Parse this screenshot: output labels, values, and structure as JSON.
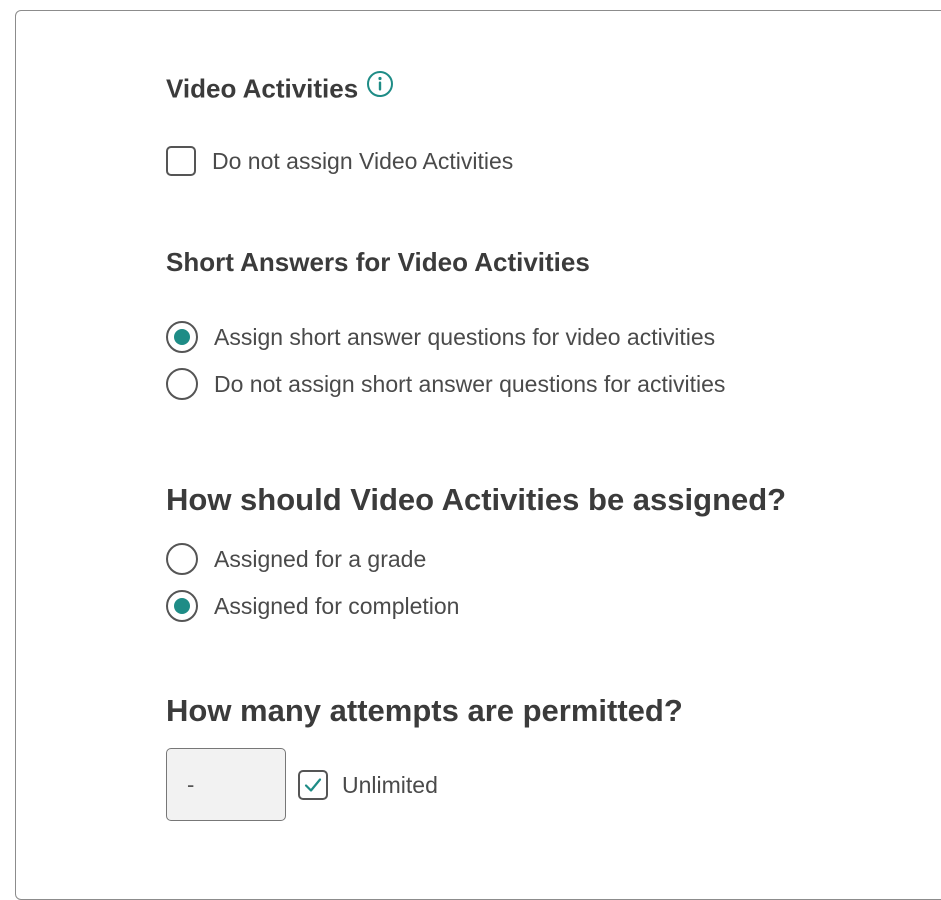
{
  "video_activities": {
    "heading": "Video Activities",
    "info_icon": "info-circle-icon",
    "do_not_assign_label": "Do not assign Video Activities",
    "do_not_assign_checked": false
  },
  "short_answers": {
    "heading": "Short Answers for Video Activities",
    "options": [
      {
        "label": "Assign short answer questions for video activities",
        "selected": true
      },
      {
        "label": "Do not assign short answer questions for activities",
        "selected": false
      }
    ]
  },
  "assignment_mode": {
    "heading": "How should Video Activities be assigned?",
    "options": [
      {
        "label": "Assigned for a grade",
        "selected": false
      },
      {
        "label": "Assigned for completion",
        "selected": true
      }
    ]
  },
  "attempts": {
    "heading": "How many attempts are permitted?",
    "input_value": "-",
    "unlimited_label": "Unlimited",
    "unlimited_checked": true
  },
  "colors": {
    "accent": "#1e8c86",
    "text": "#3b3b3b",
    "border": "#8c8c8c"
  }
}
